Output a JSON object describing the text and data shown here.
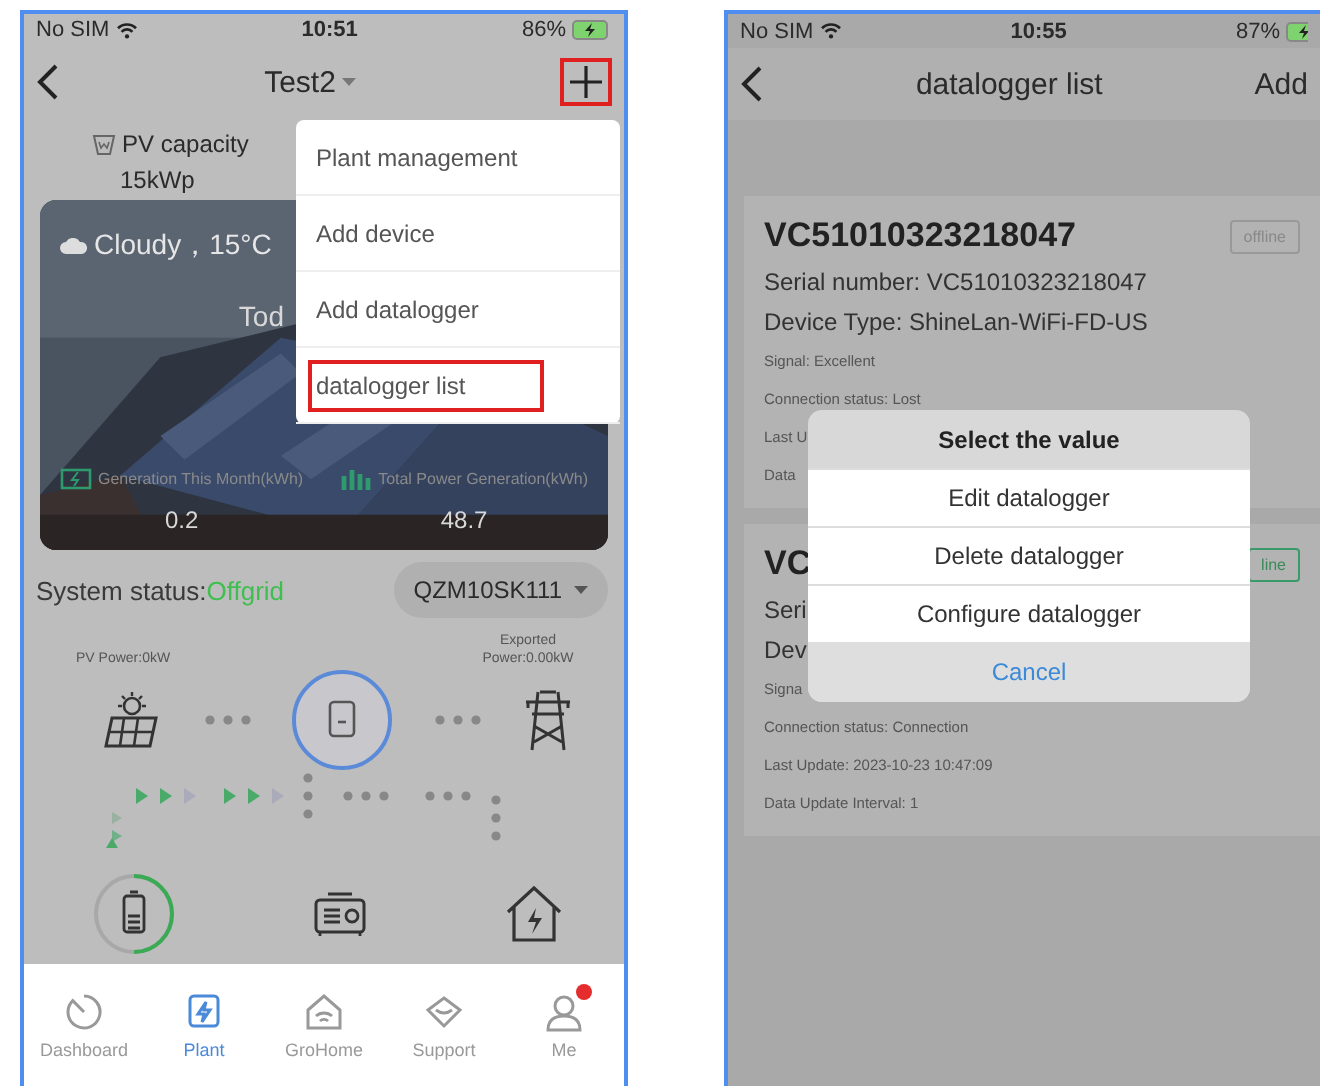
{
  "left_screen": {
    "status_bar": {
      "carrier": "No SIM",
      "time": "10:51",
      "battery": "86%"
    },
    "nav_bar": {
      "title": "Test2",
      "add_highlighted": true
    },
    "pv_capacity": {
      "label": "PV capacity",
      "value": "15kWp"
    },
    "weather_card": {
      "weather": "Cloudy，15°C",
      "today": "Tod",
      "stats": [
        {
          "label": "Generation This Month(kWh)",
          "value": "0.2"
        },
        {
          "label": "Total Power Generation(kWh)",
          "value": "48.7"
        }
      ]
    },
    "system_status": {
      "label": "System status:",
      "value": "Offgrid"
    },
    "device_selector": "QZM10SK111",
    "flow": {
      "pv_power": "PV Power:0kW",
      "exported": "Exported Power:0.00kW"
    },
    "tab_bar": [
      {
        "label": "Dashboard",
        "selected": false,
        "badge": false
      },
      {
        "label": "Plant",
        "selected": true,
        "badge": false
      },
      {
        "label": "GroHome",
        "selected": false,
        "badge": false
      },
      {
        "label": "Support",
        "selected": false,
        "badge": false
      },
      {
        "label": "Me",
        "selected": false,
        "badge": true
      }
    ],
    "menu": [
      {
        "label": "Plant management",
        "highlighted": false
      },
      {
        "label": "Add device",
        "highlighted": false
      },
      {
        "label": "Add datalogger",
        "highlighted": false
      },
      {
        "label": "datalogger list",
        "highlighted": true
      }
    ]
  },
  "right_screen": {
    "status_bar": {
      "carrier": "No SIM",
      "time": "10:55",
      "battery": "87%"
    },
    "nav_bar": {
      "title": "datalogger list",
      "action": "Add"
    },
    "cards": [
      {
        "title": "VC51010323218047",
        "badge": {
          "text": "offline",
          "online": false
        },
        "lines": [
          {
            "text": "Serial number: VC51010323218047",
            "kind": "major"
          },
          {
            "text": "Device Type: ShineLan-WiFi-FD-US",
            "kind": "major"
          },
          {
            "text": "Signal: Excellent",
            "kind": "minor"
          },
          {
            "text": "Connection status: Lost",
            "kind": "minor"
          },
          {
            "text": "Last U",
            "kind": "minor"
          },
          {
            "text": "Data",
            "kind": "minor"
          }
        ]
      },
      {
        "title": "VC",
        "badge": {
          "text": "line",
          "online": true
        },
        "lines": [
          {
            "text": "Seri",
            "kind": "major"
          },
          {
            "text": "Dev",
            "kind": "major"
          },
          {
            "text": "Signa",
            "kind": "minor"
          },
          {
            "text": "Connection status: Connection",
            "kind": "minor"
          },
          {
            "text": "Last Update: 2023-10-23 10:47:09",
            "kind": "minor"
          },
          {
            "text": "Data Update Interval: 1",
            "kind": "minor"
          }
        ]
      }
    ],
    "dialog": {
      "title": "Select the value",
      "options": [
        "Edit datalogger",
        "Delete datalogger",
        "Configure datalogger"
      ],
      "cancel": "Cancel"
    }
  }
}
